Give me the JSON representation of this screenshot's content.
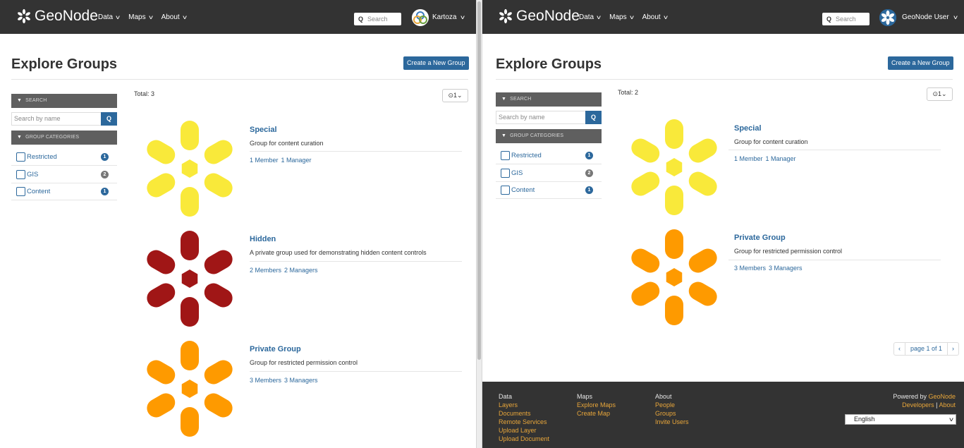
{
  "left": {
    "navbar": {
      "brand": "GeoNode",
      "menu": [
        {
          "label": "Data"
        },
        {
          "label": "Maps"
        },
        {
          "label": "About"
        }
      ],
      "search_placeholder": "Search",
      "user": "Kartoza"
    },
    "title": "Explore Groups",
    "create_button": "Create a New Group",
    "sidebar": {
      "search_header": "SEARCH",
      "search_placeholder": "Search by name",
      "categories_header": "GROUP CATEGORIES",
      "categories": [
        {
          "label": "Restricted",
          "count": "1"
        },
        {
          "label": "GIS",
          "count": "2"
        },
        {
          "label": "Content",
          "count": "1"
        }
      ]
    },
    "total": "Total: 3",
    "sort_label": "⊙1⌄",
    "groups": [
      {
        "title": "Special",
        "desc": "Group for content curation",
        "members": "1 Member",
        "managers": "1 Manager",
        "color": "#f9e93a"
      },
      {
        "title": "Hidden",
        "desc": "A private group used for demonstrating hidden content controls",
        "members": "2 Members",
        "managers": "2 Managers",
        "color": "#a01616"
      },
      {
        "title": "Private Group",
        "desc": "Group for restricted permission control",
        "members": "3 Members",
        "managers": "3 Managers",
        "color": "#fe9a00"
      }
    ]
  },
  "right": {
    "navbar": {
      "brand": "GeoNode",
      "menu": [
        {
          "label": "Data"
        },
        {
          "label": "Maps"
        },
        {
          "label": "About"
        }
      ],
      "search_placeholder": "Search",
      "user": "GeoNode User"
    },
    "title": "Explore Groups",
    "create_button": "Create a New Group",
    "sidebar": {
      "search_header": "SEARCH",
      "search_placeholder": "Search by name",
      "categories_header": "GROUP CATEGORIES",
      "categories": [
        {
          "label": "Restricted",
          "count": "1"
        },
        {
          "label": "GIS",
          "count": "2"
        },
        {
          "label": "Content",
          "count": "1"
        }
      ]
    },
    "total": "Total: 2",
    "sort_label": "⊙1⌄",
    "groups": [
      {
        "title": "Special",
        "desc": "Group for content curation",
        "members": "1 Member",
        "managers": "1 Manager",
        "color": "#f9e93a"
      },
      {
        "title": "Private Group",
        "desc": "Group for restricted permission control",
        "members": "3 Members",
        "managers": "3 Managers",
        "color": "#fe9a00"
      }
    ],
    "pager": {
      "prev": "‹",
      "label": "page 1 of 1",
      "next": "›"
    },
    "footer": {
      "columns": [
        {
          "heading": "Data",
          "links": [
            "Layers",
            "Documents",
            "Remote Services",
            "Upload Layer",
            "Upload Document"
          ]
        },
        {
          "heading": "Maps",
          "links": [
            "Explore Maps",
            "Create Map"
          ]
        },
        {
          "heading": "About",
          "links": [
            "People",
            "Groups",
            "Invite Users"
          ]
        }
      ],
      "powered_prefix": "Powered by",
      "powered_link": "GeoNode",
      "developers": "Developers",
      "about": "About",
      "language": "English"
    }
  },
  "colors": {
    "navbar": "#333333",
    "accent": "#2c689c",
    "footer_link": "#e8a63a"
  }
}
